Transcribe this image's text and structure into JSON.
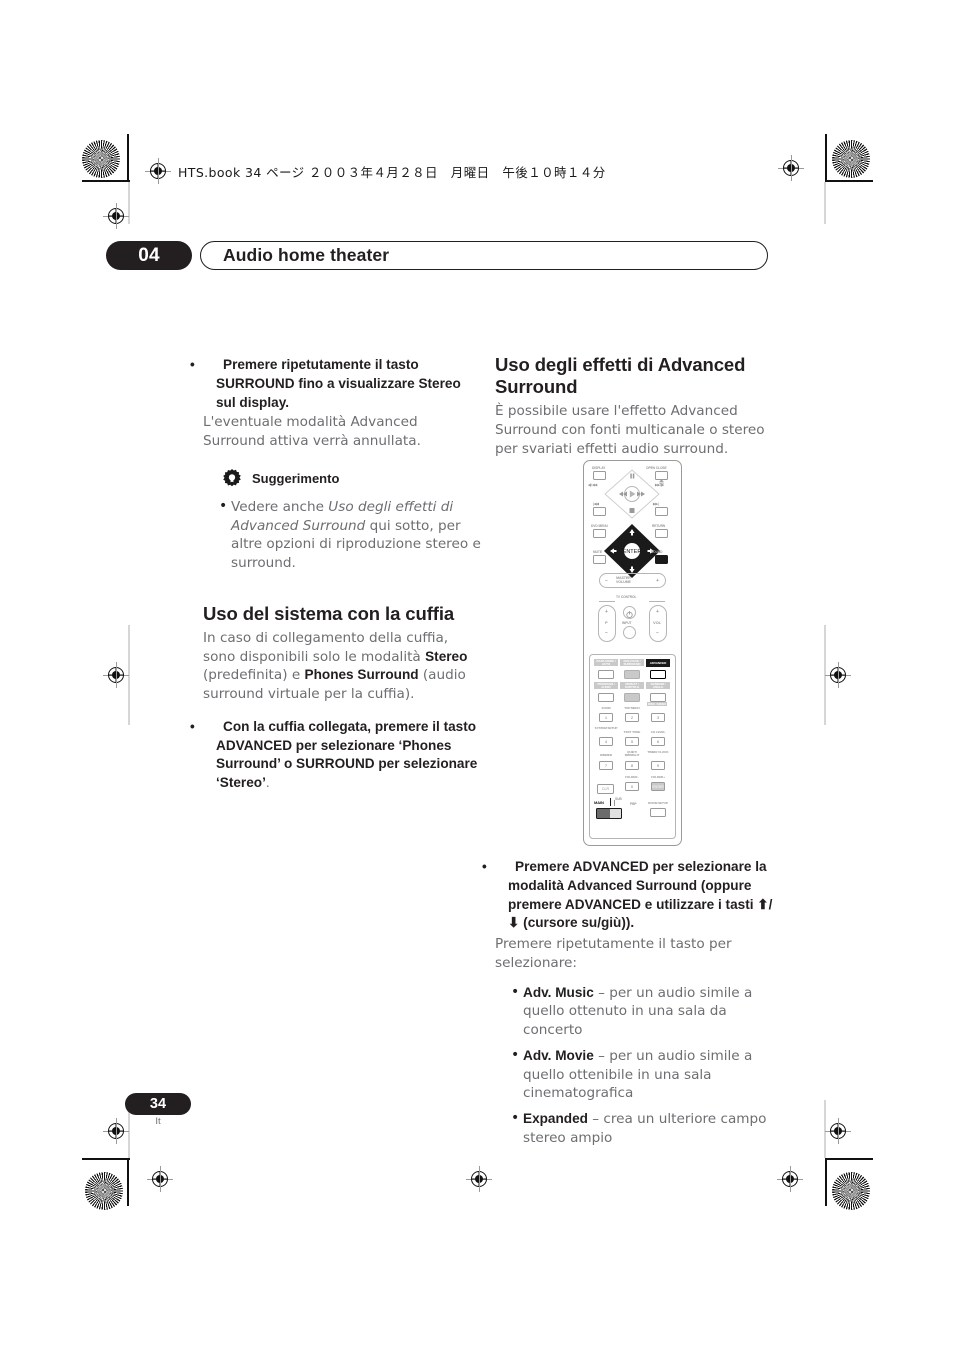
{
  "meta": {
    "file_header": "HTS.book  34 ページ  ２００３年４月２８日　月曜日　午後１０時１４分"
  },
  "header": {
    "chapter_number": "04",
    "chapter_title": "Audio home theater"
  },
  "footer": {
    "page_number": "34",
    "language_code": "It"
  },
  "left_column": {
    "bullet1": {
      "bold_text": "Premere ripetutamente il tasto SURROUND fino a visualizzare Stereo sul display.",
      "body": "L'eventuale modalità Advanced Surround attiva verrà annullata."
    },
    "tip": {
      "icon": "gear-lightbulb-icon",
      "label": "Suggerimento",
      "items": [
        {
          "pre": "Vedere anche ",
          "italic": "Uso degli effetti di Advanced Surround",
          "post": " qui sotto, per altre opzioni di riproduzione stereo e surround."
        }
      ]
    },
    "section": {
      "heading": "Uso del sistema con la cuffia",
      "paragraph_parts": [
        {
          "text": "In caso di collegamento della cuffia, sono disponibili solo le modalità ",
          "bold": false
        },
        {
          "text": "Stereo",
          "bold": true
        },
        {
          "text": " (predefinita) e ",
          "bold": false
        },
        {
          "text": "Phones Surround",
          "bold": true
        },
        {
          "text": " (audio surround virtuale per la cuffia).",
          "bold": false
        }
      ],
      "bullet_bold": "Con la cuffia collegata, premere il tasto ADVANCED per selezionare ‘Phones Surround’ o SURROUND per selezionare ‘Stereo’",
      "bullet_tail": "."
    }
  },
  "right_column": {
    "heading": "Uso degli effetti di Advanced Surround",
    "intro": "È possibile usare l'effetto Advanced Surround con fonti multicanale o stereo per svariati effetti audio surround.",
    "bullet_bold": "Premere ADVANCED per selezionare la modalità Advanced Surround (oppure premere ADVANCED e utilizzare i tasti ⬆/ ⬇ (cursore su/giù)).",
    "after_bullet": "Premere ripetutamente il tasto per selezionare:",
    "modes": [
      {
        "name": "Adv. Music",
        "desc": " – per un audio simile a quello ottenuto in una sala da concerto"
      },
      {
        "name": "Adv. Movie",
        "desc": " – per un audio simile a quello ottenibile in una sala cinematografica"
      },
      {
        "name": "Expanded",
        "desc": " – crea un ulteriore campo stereo ampio"
      }
    ]
  },
  "remote": {
    "alt": "Illustrazione del telecomando con il tasto ADVANCED evidenziato",
    "labels": {
      "display": "DISPLAY",
      "open_close": "OPEN CLOSE",
      "dvd_menu": "DVD MENU",
      "return": "RETURN",
      "mute": "MUTE",
      "sound": "SOUND",
      "enter": "ENTER",
      "master_volume": "MASTER VOLUME",
      "tv_control": "TV CONTROL",
      "input": "INPUT",
      "p": "P",
      "vol": "VOL",
      "minus": "—",
      "plus": "+",
      "scan_left": "◀|/◀◀",
      "scan_right": "▶▶/|▶",
      "main": "MAIN",
      "sub": "SUB",
      "pbp": "PBP"
    },
    "keypad": [
      {
        "caption": "BASS MODE / AUTO",
        "dark": false
      },
      {
        "caption": "DIALOGUE / SURROUND",
        "dark": false
      },
      {
        "caption": "ADVANCED",
        "dark": true
      },
      {
        "caption": "PROGRAM / AUDIO",
        "dark": false
      },
      {
        "caption": "REPEAT / SUBTITLE",
        "dark": false
      },
      {
        "caption": "RANDOM / ANGLE",
        "dark": false
      },
      {
        "caption": "ZOOM",
        "num": "1"
      },
      {
        "caption": "TOP MENU",
        "num": "2"
      },
      {
        "caption": "DISC / MENU",
        "num": "3"
      },
      {
        "caption": "SYSTEM SETUP",
        "num": "4"
      },
      {
        "caption": "TEST TONE",
        "num": "5"
      },
      {
        "caption": "CH LEVEL",
        "num": "6"
      },
      {
        "caption": "DIMMER",
        "num": "7"
      },
      {
        "caption": "QUIET/ MIDNIGHT",
        "num": "8"
      },
      {
        "caption": "TIMER/ CLOCK",
        "num": "9"
      },
      {
        "caption": "CLR",
        "num": ""
      },
      {
        "caption": "FOLDER–",
        "num": "0"
      },
      {
        "caption": "FOLDER+",
        "num": "ENTER"
      },
      {
        "caption": "ROOM SETUP",
        "num": ""
      }
    ]
  }
}
